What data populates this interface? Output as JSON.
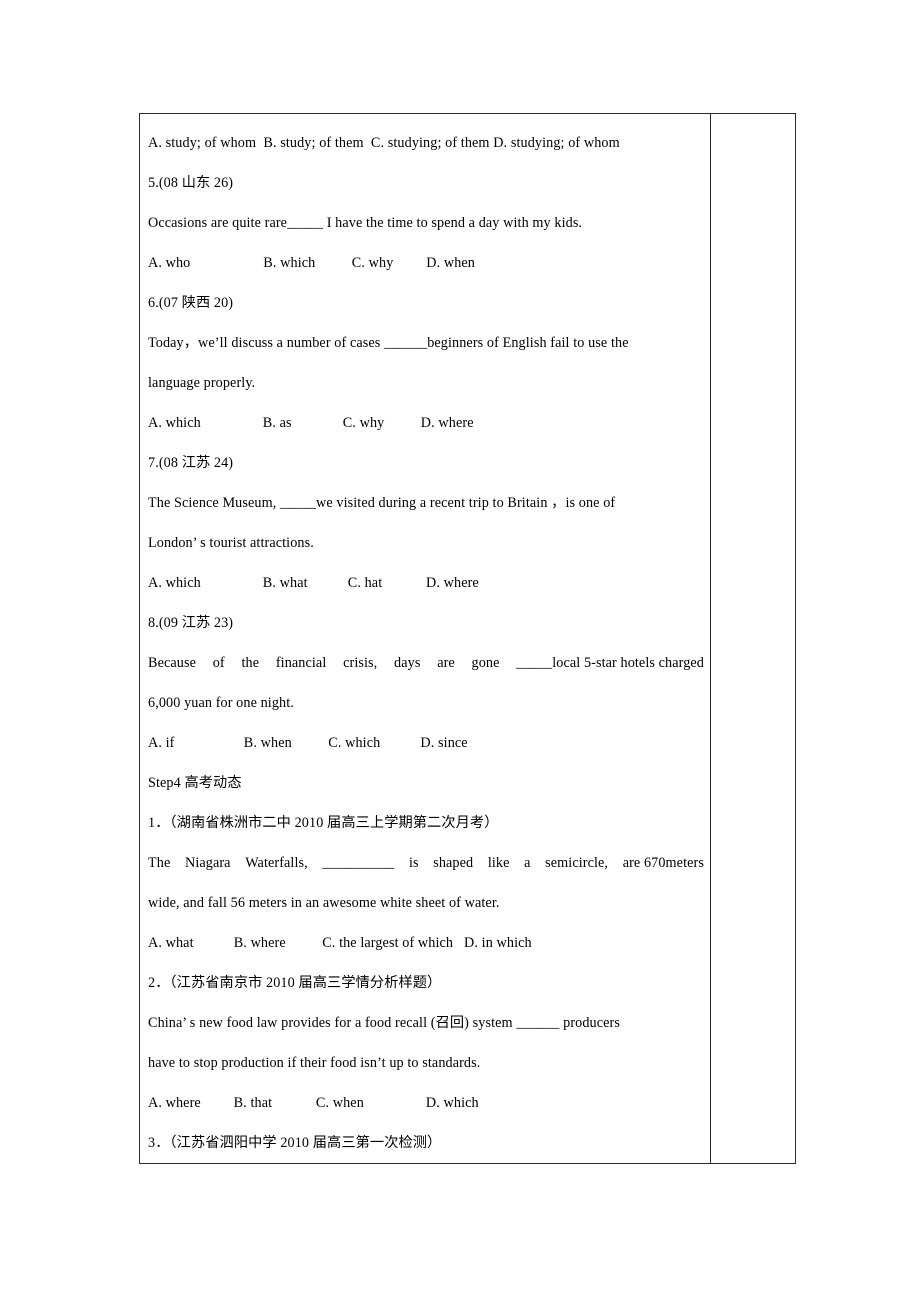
{
  "document": {
    "type": "exam-worksheet",
    "language": "en-zh",
    "section_heading": "Step4  高考动态"
  },
  "table": {
    "columns": 2,
    "main_column_label": "question-content",
    "side_column_label": "notes-column",
    "side_column_content": ""
  },
  "lines": [
    {
      "id": "q4-options",
      "kind": "options",
      "text": "A. study; of whom  B. study; of them  C. studying; of them D. studying; of whom"
    },
    {
      "id": "q5-head",
      "kind": "heading",
      "text": "5.(08 山东 26)"
    },
    {
      "id": "q5-stem",
      "kind": "stem",
      "text": "Occasions are quite rare_____ I have the time to spend a day with my kids."
    },
    {
      "id": "q5-options",
      "kind": "options",
      "text": "A. who                    B. which          C. why         D. when"
    },
    {
      "id": "q6-head",
      "kind": "heading",
      "text": "6.(07 陕西 20)"
    },
    {
      "id": "q6-stem-1",
      "kind": "stem",
      "text": "Today，we’ll discuss a number of cases ______beginners of English fail to use the"
    },
    {
      "id": "q6-stem-2",
      "kind": "stem",
      "text": "language properly."
    },
    {
      "id": "q6-options",
      "kind": "options",
      "text": "A. which                 B. as              C. why          D. where"
    },
    {
      "id": "q7-head",
      "kind": "heading",
      "text": "7.(08 江苏 24)"
    },
    {
      "id": "q7-stem-1",
      "kind": "stem",
      "text": "The Science Museum, _____we visited during a recent trip to Britain ，is one of"
    },
    {
      "id": "q7-stem-2",
      "kind": "stem",
      "text": "London’ s tourist attractions."
    },
    {
      "id": "q7-options",
      "kind": "options",
      "text": "A. which                 B. what           C. hat            D. where"
    },
    {
      "id": "q8-head",
      "kind": "heading",
      "text": "8.(09 江苏 23)"
    },
    {
      "id": "q8-stem-1",
      "kind": "stem",
      "text": "Because of the financial crisis, days are gone _____local 5-star hotels charged"
    },
    {
      "id": "q8-stem-2",
      "kind": "stem",
      "text": "6,000 yuan for one night."
    },
    {
      "id": "q8-options",
      "kind": "options",
      "text": "A. if                   B. when          C. which           D. since"
    },
    {
      "id": "step4-head",
      "kind": "section",
      "text": "Step4  高考动态"
    },
    {
      "id": "s4-q1-head",
      "kind": "heading",
      "text": "1．（湖南省株洲市二中 2010 届高三上学期第二次月考）"
    },
    {
      "id": "s4-q1-stem-1",
      "kind": "stem",
      "text": "The Niagara Waterfalls, __________ is shaped like a semicircle, are 670meters"
    },
    {
      "id": "s4-q1-stem-2",
      "kind": "stem",
      "text": "wide, and fall 56 meters in an awesome white sheet of water."
    },
    {
      "id": "s4-q1-options",
      "kind": "options",
      "text": "A. what           B. where          C. the largest of which   D. in which"
    },
    {
      "id": "s4-q2-head",
      "kind": "heading",
      "text": "2．（江苏省南京市 2010 届高三学情分析样题）"
    },
    {
      "id": "s4-q2-stem-1",
      "kind": "stem",
      "text": "China’ s new food law provides for a food recall (召回) system ______ producers"
    },
    {
      "id": "s4-q2-stem-2",
      "kind": "stem",
      "text": "have to stop production if their food isn’t up to standards."
    },
    {
      "id": "s4-q2-options",
      "kind": "options",
      "text": "A. where         B. that            C. when                 D. which"
    },
    {
      "id": "s4-q3-head",
      "kind": "heading",
      "text": "3．（江苏省泗阳中学 2010 届高三第一次检测）"
    }
  ],
  "justified": {
    "q8-stem-1": [
      "Because",
      "of",
      "the",
      "financial",
      "crisis,",
      "days",
      "are",
      "gone",
      "_____local 5-star hotels charged"
    ],
    "s4-q1-stem-1": [
      "The",
      "Niagara",
      "Waterfalls,",
      "__________",
      "is",
      "shaped",
      "like",
      "a",
      "semicircle,",
      "are 670meters"
    ]
  },
  "colors": {
    "text": "#000000",
    "border": "#2b2b2b",
    "page_background": "#ffffff"
  }
}
